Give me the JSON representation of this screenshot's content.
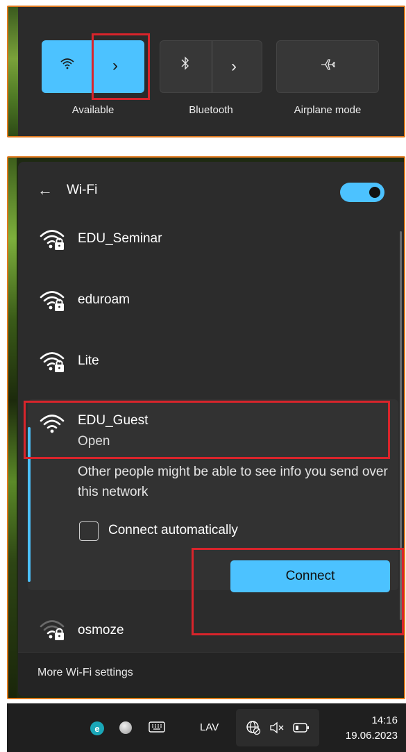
{
  "quick_settings": {
    "wifi_label": "Available",
    "bluetooth_label": "Bluetooth",
    "airplane_label": "Airplane mode",
    "wifi_icon": "wifi-icon",
    "bluetooth_icon": "bluetooth-icon",
    "airplane_icon": "airplane-icon",
    "chevron": "›"
  },
  "wifi_panel": {
    "back": "←",
    "title": "Wi-Fi",
    "toggle_on": true,
    "networks": [
      {
        "name": "EDU_Seminar",
        "secured": true
      },
      {
        "name": "eduroam",
        "secured": true
      },
      {
        "name": "Lite",
        "secured": true
      }
    ],
    "selected": {
      "name": "EDU_Guest",
      "status": "Open",
      "warning": "Other people might be able to see info you send over this network",
      "auto_connect_label": "Connect automatically",
      "auto_connect_checked": false,
      "connect_label": "Connect"
    },
    "below": {
      "name": "osmoze",
      "secured": true
    },
    "more_settings": "More Wi-Fi settings"
  },
  "taskbar": {
    "language": "LAV",
    "time": "14:16",
    "date": "19.06.2023",
    "eset_letter": "e"
  },
  "colors": {
    "accent": "#4cc2ff",
    "highlight": "#d9242b",
    "frame": "#e07a1f"
  }
}
